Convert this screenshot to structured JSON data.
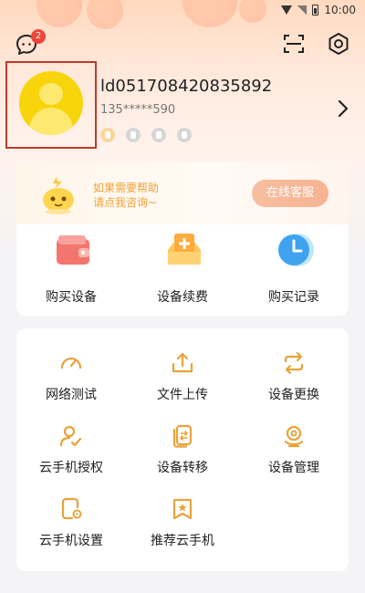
{
  "status_bar": {
    "time": "10:00"
  },
  "topbar": {
    "message_badge": "2"
  },
  "user": {
    "id": "ld051708420835892",
    "phone": "135*****590"
  },
  "help": {
    "line1": "如果需要帮助",
    "line2": "请点我咨询~",
    "button": "在线客服"
  },
  "quick": [
    {
      "label": "购买设备",
      "icon": "wallet-icon"
    },
    {
      "label": "设备续费",
      "icon": "renew-box-icon"
    },
    {
      "label": "购买记录",
      "icon": "clock-icon"
    }
  ],
  "grid": [
    {
      "label": "网络测试",
      "icon": "speedometer-icon"
    },
    {
      "label": "文件上传",
      "icon": "upload-icon"
    },
    {
      "label": "设备更换",
      "icon": "swap-icon"
    },
    {
      "label": "云手机授权",
      "icon": "user-check-icon"
    },
    {
      "label": "设备转移",
      "icon": "transfer-icon"
    },
    {
      "label": "设备管理",
      "icon": "device-manage-icon"
    },
    {
      "label": "云手机设置",
      "icon": "phone-settings-icon"
    },
    {
      "label": "推荐云手机",
      "icon": "recommend-icon"
    }
  ],
  "colors": {
    "accent": "#f0a23a",
    "badge": "#f0433a",
    "avatar": "#f8d40b"
  }
}
